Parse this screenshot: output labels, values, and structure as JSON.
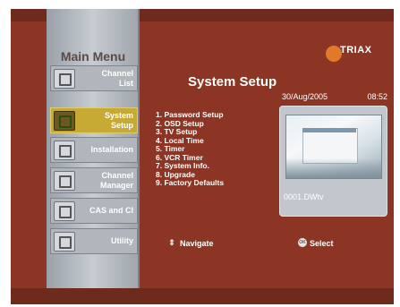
{
  "sidebar": {
    "title": "Main Menu",
    "items": [
      {
        "label_lines": [
          "Channel",
          "List"
        ],
        "icon": "channel-list-icon"
      },
      {
        "label_lines": [
          "System",
          "Setup"
        ],
        "icon": "system-setup-icon",
        "selected": true
      },
      {
        "label_lines": [
          "Installation"
        ],
        "icon": "installation-icon"
      },
      {
        "label_lines": [
          "Channel",
          "Manager"
        ],
        "icon": "channel-manager-icon"
      },
      {
        "label_lines": [
          "CAS and CI"
        ],
        "icon": "cas-ci-icon"
      },
      {
        "label_lines": [
          "Utility"
        ],
        "icon": "utility-icon"
      }
    ]
  },
  "brand": "TRIAX",
  "page": {
    "title": "System Setup",
    "options": [
      "1. Password Setup",
      "2. OSD Setup",
      "3. TV Setup",
      "4. Local Time",
      "5. Timer",
      "6. VCR Timer",
      "7. System Info.",
      "8. Upgrade",
      "9. Factory Defaults"
    ]
  },
  "status": {
    "date": "30/Aug/2005",
    "time": "08:52"
  },
  "preview": {
    "channel": "0001.DWtv"
  },
  "hints": {
    "navigate": "Navigate",
    "select": "Select",
    "ok_glyph": "OK",
    "nav_glyph": "⇕"
  },
  "colors": {
    "background": "#8c3524",
    "selected": "#c7aa33",
    "sidebar": "#b1b6bc"
  }
}
